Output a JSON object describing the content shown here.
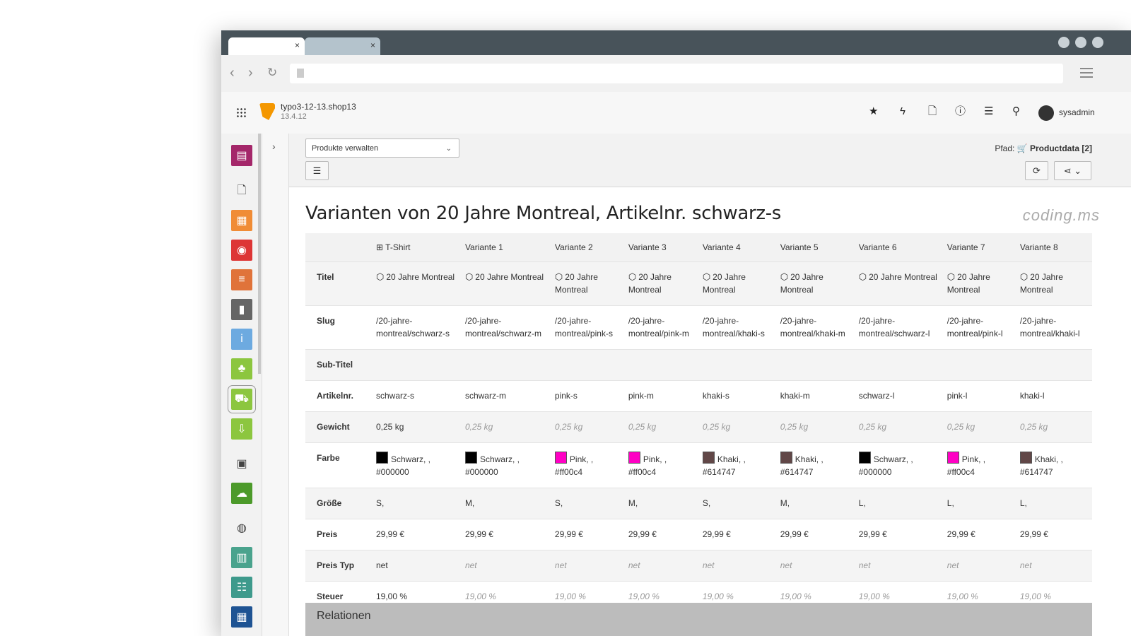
{
  "browser": {
    "tabs": [
      {
        "close": "×"
      },
      {
        "close": "×"
      }
    ],
    "nav": {
      "back": "‹",
      "forward": "›",
      "reload": "↻"
    }
  },
  "header": {
    "site_name": "typo3-12-13.shop13",
    "version": "13.4.12",
    "user": "sysadmin",
    "toolbar_icons": [
      "star-icon",
      "flash-icon",
      "document-icon",
      "help-icon",
      "list-icon",
      "search-icon"
    ]
  },
  "module_menu": [
    {
      "icon": "web-layout-icon",
      "color": "#a4276a"
    },
    {
      "icon": "page-icon",
      "color": "transparent"
    },
    {
      "icon": "list-module-icon",
      "color": "#f08c36"
    },
    {
      "icon": "view-icon",
      "color": "#dd3636"
    },
    {
      "icon": "records-icon",
      "color": "#e0733a"
    },
    {
      "icon": "recycler-icon",
      "color": "#666666"
    },
    {
      "icon": "info-icon",
      "color": "#6daae0"
    },
    {
      "icon": "users-icon",
      "color": "#8cc63f"
    },
    {
      "icon": "shop-icon",
      "color": "#8cc63f",
      "active": true
    },
    {
      "icon": "import-icon",
      "color": "#8cc63f"
    },
    {
      "icon": "media-icon",
      "color": "transparent"
    },
    {
      "icon": "cloud-icon",
      "color": "#4c9a2a"
    },
    {
      "icon": "globe-icon",
      "color": "transparent"
    },
    {
      "icon": "form-icon",
      "color": "#4aa38d"
    },
    {
      "icon": "settings-icon",
      "color": "#3e9a8c"
    },
    {
      "icon": "template-icon",
      "color": "#1e5393"
    }
  ],
  "docheader": {
    "select_value": "Produkte verwalten",
    "path_label": "Pfad:",
    "path_value": "Productdata [2]"
  },
  "page": {
    "title": "Varianten von 20 Jahre Montreal, Artikelnr. schwarz-s",
    "brand": "coding.ms",
    "relations": "Relationen"
  },
  "table": {
    "columns": [
      "T-Shirt",
      "Variante 1",
      "Variante 2",
      "Variante 3",
      "Variante 4",
      "Variante 5",
      "Variante 6",
      "Variante 7",
      "Variante 8"
    ],
    "titel": "20 Jahre Montreal",
    "rows": {
      "titel_label": "Titel",
      "slug_label": "Slug",
      "subtitel_label": "Sub-Titel",
      "artikelnr_label": "Artikelnr.",
      "gewicht_label": "Gewicht",
      "farbe_label": "Farbe",
      "groesse_label": "Größe",
      "preis_label": "Preis",
      "preistyp_label": "Preis Typ",
      "steuer_label": "Steuer"
    },
    "slugs": [
      "/20-jahre-montreal/schwarz-s",
      "/20-jahre-montreal/schwarz-m",
      "/20-jahre-montreal/pink-s",
      "/20-jahre-montreal/pink-m",
      "/20-jahre-montreal/khaki-s",
      "/20-jahre-montreal/khaki-m",
      "/20-jahre-montreal/schwarz-l",
      "/20-jahre-montreal/pink-l",
      "/20-jahre-montreal/khaki-l"
    ],
    "artikelnr": [
      "schwarz-s",
      "schwarz-m",
      "pink-s",
      "pink-m",
      "khaki-s",
      "khaki-m",
      "schwarz-l",
      "pink-l",
      "khaki-l"
    ],
    "gewicht": "0,25 kg",
    "farben": [
      {
        "name": "Schwarz, ,",
        "hex": "#000000"
      },
      {
        "name": "Schwarz, ,",
        "hex": "#000000"
      },
      {
        "name": "Pink, ,",
        "hex": "#ff00c4"
      },
      {
        "name": "Pink, ,",
        "hex": "#ff00c4"
      },
      {
        "name": "Khaki, ,",
        "hex": "#614747"
      },
      {
        "name": "Khaki, ,",
        "hex": "#614747"
      },
      {
        "name": "Schwarz, ,",
        "hex": "#000000"
      },
      {
        "name": "Pink, ,",
        "hex": "#ff00c4"
      },
      {
        "name": "Khaki, ,",
        "hex": "#614747"
      }
    ],
    "groessen": [
      "S,",
      "M,",
      "S,",
      "M,",
      "S,",
      "M,",
      "L,",
      "L,",
      "L,"
    ],
    "preis": "29,99 €",
    "preis_typ": "net",
    "steuer": "19,00 %"
  }
}
